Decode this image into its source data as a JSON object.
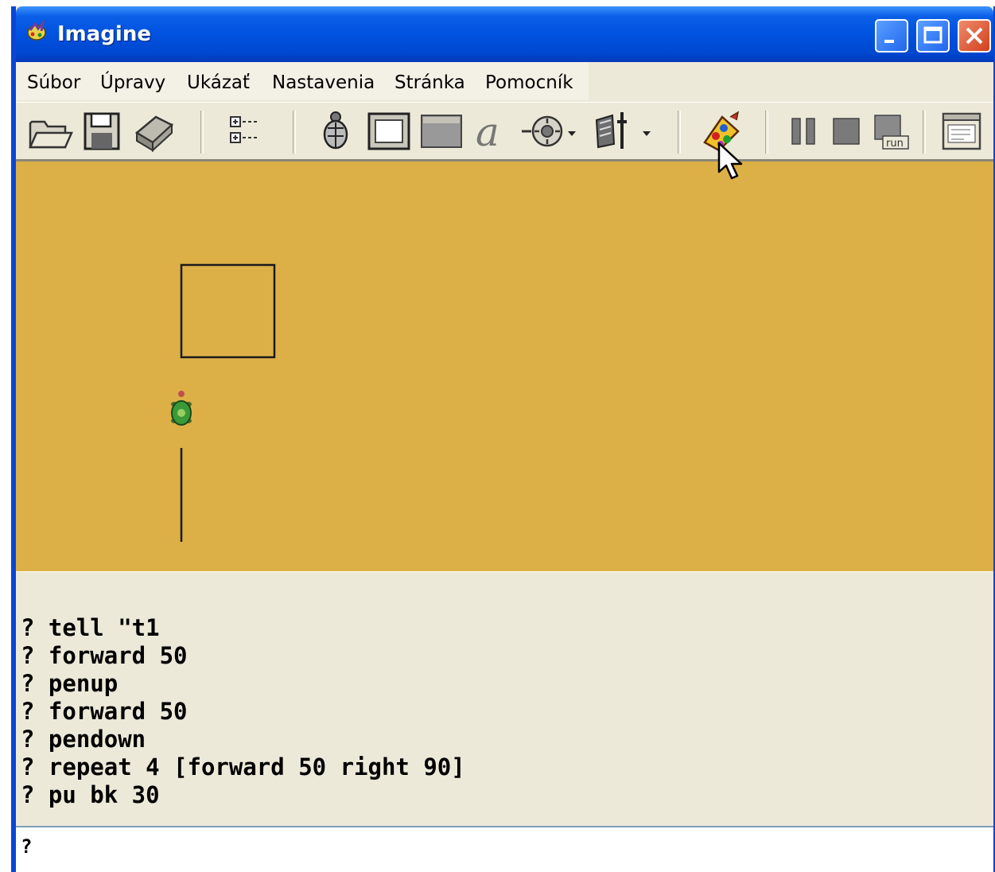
{
  "window": {
    "title": "Imagine",
    "accent": "#0a45d8"
  },
  "menu": [
    "Súbor",
    "Úpravy",
    "Ukázať",
    "Nastavenia",
    "Stránka",
    "Pomocník"
  ],
  "toolbar_icons": [
    "open-folder-icon",
    "save-icon",
    "print-icon",
    "tree-view-icon",
    "turtle-icon",
    "frame-icon",
    "pane-icon",
    "text-icon",
    "joystick-icon",
    "shape-tool-icon",
    "paint-turtle-icon",
    "pause-icon",
    "stop-icon",
    "run-icon",
    "window-icon"
  ],
  "toolbar_run_label": "run",
  "canvas": {
    "background": "#dcb047"
  },
  "console": {
    "lines": [
      "? tell \"t1",
      "? forward 50",
      "? penup",
      "? forward 50",
      "? pendown",
      "? repeat 4 [forward 50 right 90]",
      "? pu bk 30"
    ]
  },
  "input": {
    "prompt": "?"
  }
}
